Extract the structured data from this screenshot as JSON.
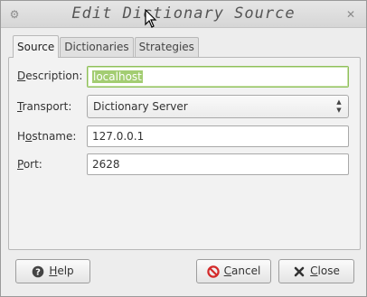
{
  "window": {
    "title": "Edit Dictionary Source",
    "close_glyph": "✕",
    "menu_glyph": "⚙"
  },
  "tabs": [
    {
      "label": "Source",
      "active": true
    },
    {
      "label": "Dictionaries",
      "active": false
    },
    {
      "label": "Strategies",
      "active": false
    }
  ],
  "form": {
    "description": {
      "mnemonic": "D",
      "rest": "escription:",
      "value": "localhost"
    },
    "transport": {
      "mnemonic": "T",
      "rest": "ransport:",
      "value": "Dictionary Server",
      "arrows": "▲▼"
    },
    "hostname": {
      "pre": "H",
      "mnemonic": "o",
      "rest": "stname:",
      "value": "127.0.0.1"
    },
    "port": {
      "mnemonic": "P",
      "rest": "ort:",
      "value": "2628"
    }
  },
  "buttons": {
    "help": {
      "mnemonic": "H",
      "rest": "elp",
      "icon": "help-icon"
    },
    "cancel": {
      "mnemonic": "C",
      "rest": "ancel",
      "icon": "cancel-icon"
    },
    "close": {
      "mnemonic": "C",
      "rest": "lose",
      "icon": "close-x-icon"
    }
  },
  "colors": {
    "focus_border": "#8fbf5a",
    "selection": "#a3cd72",
    "cancel_red": "#d42a2a"
  }
}
